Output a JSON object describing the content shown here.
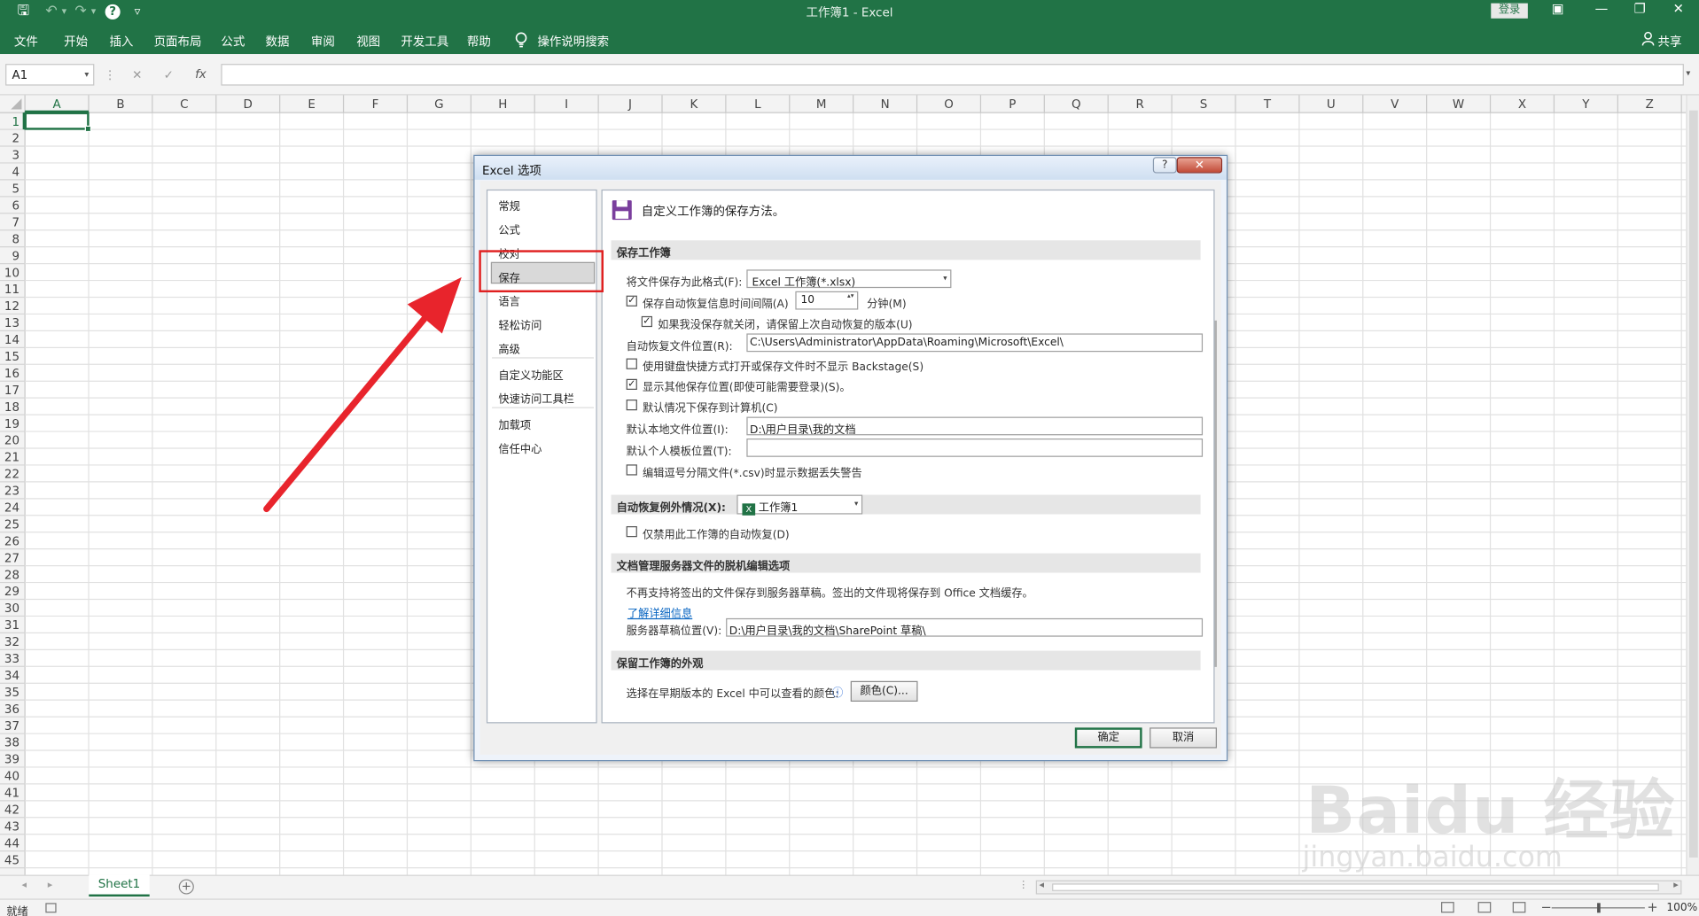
{
  "window": {
    "title": "工作簿1  -  Excel",
    "login": "登录",
    "share": "共享",
    "min": "—",
    "restore": "❐",
    "close": "✕",
    "ribbon_opts": "▣"
  },
  "qat": {
    "save": "🖫",
    "undo": "↶",
    "undo_caret": "▾",
    "redo": "↷",
    "redo_caret": "▾",
    "help": "?",
    "more": "▿"
  },
  "ribbon_tabs": [
    "文件",
    "开始",
    "插入",
    "页面布局",
    "公式",
    "数据",
    "审阅",
    "视图",
    "开发工具",
    "帮助"
  ],
  "tell_me": "操作说明搜索",
  "formula_bar": {
    "name_box": "A1",
    "name_caret": "▾",
    "sep": "⋮",
    "cancel": "✕",
    "enter": "✓",
    "fx": "fx",
    "value": "",
    "expand": "▾"
  },
  "columns": [
    "A",
    "B",
    "C",
    "D",
    "E",
    "F",
    "G",
    "H",
    "I",
    "J",
    "K",
    "L",
    "M",
    "N",
    "O",
    "P",
    "Q",
    "R",
    "S",
    "T",
    "U",
    "V",
    "W",
    "X",
    "Y",
    "Z"
  ],
  "rows": [
    "1",
    "2",
    "3",
    "4",
    "5",
    "6",
    "7",
    "8",
    "9",
    "10",
    "11",
    "12",
    "13",
    "14",
    "15",
    "16",
    "17",
    "18",
    "19",
    "20",
    "21",
    "22",
    "23",
    "24",
    "25",
    "26",
    "27",
    "28",
    "29",
    "30",
    "31",
    "32",
    "33",
    "34",
    "35",
    "36",
    "37",
    "38",
    "39",
    "40",
    "41",
    "42",
    "43",
    "44",
    "45"
  ],
  "active_cell": "A1",
  "sheets": {
    "tabs": [
      "Sheet1"
    ],
    "prev": "◂",
    "next": "▸",
    "add": "+",
    "more": "⋮",
    "hprev": "◂",
    "hnext": "▸"
  },
  "status": {
    "ready": "就绪",
    "zoom_minus": "−",
    "zoom_plus": "+",
    "zoom": "100%"
  },
  "dialog": {
    "title": "Excel 选项",
    "help": "?",
    "close": "✕",
    "nav": [
      "常规",
      "公式",
      "校对",
      "保存",
      "语言",
      "轻松访问",
      "高级",
      "自定义功能区",
      "快速访问工具栏",
      "加载项",
      "信任中心"
    ],
    "selected_nav": "保存",
    "header": "自定义工作簿的保存方法。",
    "sections": {
      "save_workbooks": "保存工作簿",
      "autorecover_exceptions": "自动恢复例外情况(X):",
      "offline_editing": "文档管理服务器文件的脱机编辑选项",
      "preserve_appearance": "保留工作簿的外观"
    },
    "save_format_label": "将文件保存为此格式(F):",
    "save_format_value": "Excel 工作簿(*.xlsx)",
    "autorecover_label": "保存自动恢复信息时间间隔(A)",
    "autorecover_minutes": "10",
    "minutes_label": "分钟(M)",
    "keep_last_label": "如果我没保存就关闭，请保留上次自动恢复的版本(U)",
    "autorecover_location_label": "自动恢复文件位置(R):",
    "autorecover_location_value": "C:\\Users\\Administrator\\AppData\\Roaming\\Microsoft\\Excel\\",
    "no_backstage_label": "使用键盘快捷方式打开或保存文件时不显示 Backstage(S)",
    "show_other_locations_label": "显示其他保存位置(即使可能需要登录)(S)。",
    "save_to_computer_label": "默认情况下保存到计算机(C)",
    "default_local_label": "默认本地文件位置(I):",
    "default_local_value": "D:\\用户目录\\我的文档",
    "default_template_label": "默认个人模板位置(T):",
    "default_template_value": "",
    "csv_warning_label": "编辑逗号分隔文件(*.csv)时显示数据丢失警告",
    "autorecover_workbook": "工作簿1",
    "autorecover_workbook_icon": "X",
    "disable_autorecover_label": "仅禁用此工作簿的自动恢复(D)",
    "offline_desc": "不再支持将签出的文件保存到服务器草稿。签出的文件现将保存到 Office 文档缓存。",
    "learn_more": "了解详细信息",
    "server_drafts_label": "服务器草稿位置(V):",
    "server_drafts_value": "D:\\用户目录\\我的文档\\SharePoint 草稿\\",
    "colors_label": "选择在早期版本的 Excel 中可以查看的颜色:",
    "info_icon": "ⓘ",
    "colors_button": "颜色(C)...",
    "ok": "确定",
    "cancel": "取消",
    "caret": "▾",
    "check": "✓",
    "spin": "▴▾",
    "checkboxes": {
      "autorecover": true,
      "keep_last": true,
      "no_backstage": false,
      "show_other": true,
      "save_to_computer": false,
      "csv_warning": false,
      "disable_autorecover": false
    }
  },
  "watermark": {
    "brand": "Baidu 经验",
    "url": "jingyan.baidu.com"
  },
  "colors": {
    "excel_green": "#217346",
    "highlight_red": "#e02020",
    "arrow_red": "#e8242c"
  }
}
